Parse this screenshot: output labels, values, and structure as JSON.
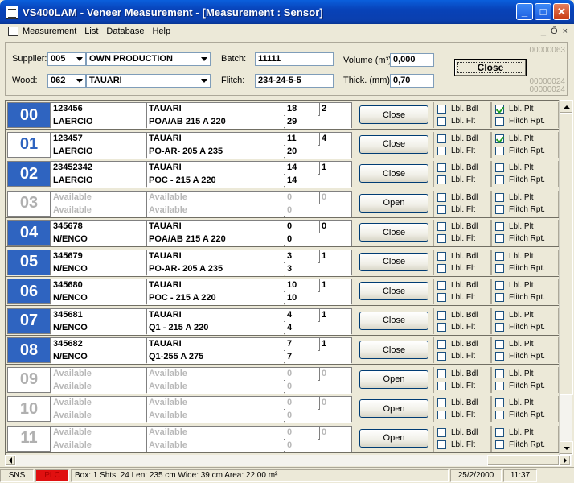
{
  "window": {
    "title": "VS400LAM - Veneer Measurement - [Measurement : Sensor]"
  },
  "menu": {
    "items": [
      "Measurement",
      "List",
      "Database",
      "Help"
    ],
    "mdi_controls": [
      "_",
      "Ő",
      "×"
    ]
  },
  "form": {
    "supplier_label": "Supplier:",
    "supplier_code": "005",
    "supplier_name": "OWN PRODUCTION",
    "wood_label": "Wood:",
    "wood_code": "062",
    "wood_name": "TAUARI",
    "batch_label": "Batch:",
    "batch_value": "11111",
    "flitch_label": "Flitch:",
    "flitch_value": "234-24-5-5",
    "volume_label": "Volume (m³):",
    "volume_value": "0,000",
    "thick_label": "Thick. (mm):",
    "thick_value": "0,70",
    "close_button": "Close",
    "code_top": "00000063",
    "code_bottom1": "00000024",
    "code_bottom2": "00000024"
  },
  "rows": [
    {
      "num": "00",
      "state": "busy",
      "c1a": "123456",
      "c1b": "LAERCIO",
      "c2a": "TAUARI",
      "c2b": "POA/AB 215 A 220",
      "c3a": "18",
      "c3b": "29",
      "c4a": "2",
      "btn": "Close",
      "lbl_bdl": false,
      "lbl_plt": true
    },
    {
      "num": "01",
      "state": "sel",
      "c1a": "123457",
      "c1b": "LAERCIO",
      "c2a": "TAUARI",
      "c2b": "PO-AR- 205 A 235",
      "c3a": "11",
      "c3b": "20",
      "c4a": "4",
      "btn": "Close",
      "lbl_bdl": false,
      "lbl_plt": true
    },
    {
      "num": "02",
      "state": "busy",
      "c1a": "23452342",
      "c1b": "LAERCIO",
      "c2a": "TAUARI",
      "c2b": "POC - 215 A 220",
      "c3a": "14",
      "c3b": "14",
      "c4a": "1",
      "btn": "Close",
      "lbl_bdl": false,
      "lbl_plt": false
    },
    {
      "num": "03",
      "state": "free",
      "c1a": "Available",
      "c1b": "Available",
      "c2a": "Available",
      "c2b": "Available",
      "c3a": "0",
      "c3b": "0",
      "c4a": "0",
      "btn": "Open",
      "lbl_bdl": false,
      "lbl_plt": false
    },
    {
      "num": "04",
      "state": "busy",
      "c1a": "345678",
      "c1b": "N/ENCO",
      "c2a": "TAUARI",
      "c2b": "POA/AB 215 A 220",
      "c3a": "0",
      "c3b": "0",
      "c4a": "0",
      "btn": "Close",
      "lbl_bdl": false,
      "lbl_plt": false
    },
    {
      "num": "05",
      "state": "busy",
      "c1a": "345679",
      "c1b": "N/ENCO",
      "c2a": "TAUARI",
      "c2b": "PO-AR- 205 A 235",
      "c3a": "3",
      "c3b": "3",
      "c4a": "1",
      "btn": "Close",
      "lbl_bdl": false,
      "lbl_plt": false
    },
    {
      "num": "06",
      "state": "busy",
      "c1a": "345680",
      "c1b": "N/ENCO",
      "c2a": "TAUARI",
      "c2b": "POC - 215 A 220",
      "c3a": "10",
      "c3b": "10",
      "c4a": "1",
      "btn": "Close",
      "lbl_bdl": false,
      "lbl_plt": false
    },
    {
      "num": "07",
      "state": "busy",
      "c1a": "345681",
      "c1b": "N/ENCO",
      "c2a": "TAUARI",
      "c2b": "Q1 -  215  A  220",
      "c3a": "4",
      "c3b": "4",
      "c4a": "1",
      "btn": "Close",
      "lbl_bdl": false,
      "lbl_plt": false
    },
    {
      "num": "08",
      "state": "busy",
      "c1a": "345682",
      "c1b": "N/ENCO",
      "c2a": "TAUARI",
      "c2b": "Q1-255 A 275",
      "c3a": "7",
      "c3b": "7",
      "c4a": "1",
      "btn": "Close",
      "lbl_bdl": false,
      "lbl_plt": false
    },
    {
      "num": "09",
      "state": "free",
      "c1a": "Available",
      "c1b": "Available",
      "c2a": "Available",
      "c2b": "Available",
      "c3a": "0",
      "c3b": "0",
      "c4a": "0",
      "btn": "Open",
      "lbl_bdl": false,
      "lbl_plt": false
    },
    {
      "num": "10",
      "state": "free",
      "c1a": "Available",
      "c1b": "Available",
      "c2a": "Available",
      "c2b": "Available",
      "c3a": "0",
      "c3b": "0",
      "c4a": "0",
      "btn": "Open",
      "lbl_bdl": false,
      "lbl_plt": false
    },
    {
      "num": "11",
      "state": "free",
      "c1a": "Available",
      "c1b": "Available",
      "c2a": "Available",
      "c2b": "Available",
      "c3a": "0",
      "c3b": "0",
      "c4a": "0",
      "btn": "Open",
      "lbl_bdl": false,
      "lbl_plt": false
    }
  ],
  "checkbox_labels": {
    "bdl": "Lbl. Bdl",
    "flt": "Lbl. Flt",
    "plt": "Lbl. Plt",
    "rpt": "Flitch Rpt."
  },
  "status": {
    "sns": "SNS",
    "plc": "PLC",
    "info": "Box: 1  Shts: 24  Len: 235 cm  Wide: 39 cm  Area: 22,00 m²",
    "date": "25/2/2000",
    "time": "11:37"
  },
  "colors": {
    "slot_busy": "#2f64c0",
    "plc_alarm": "#e01010"
  }
}
